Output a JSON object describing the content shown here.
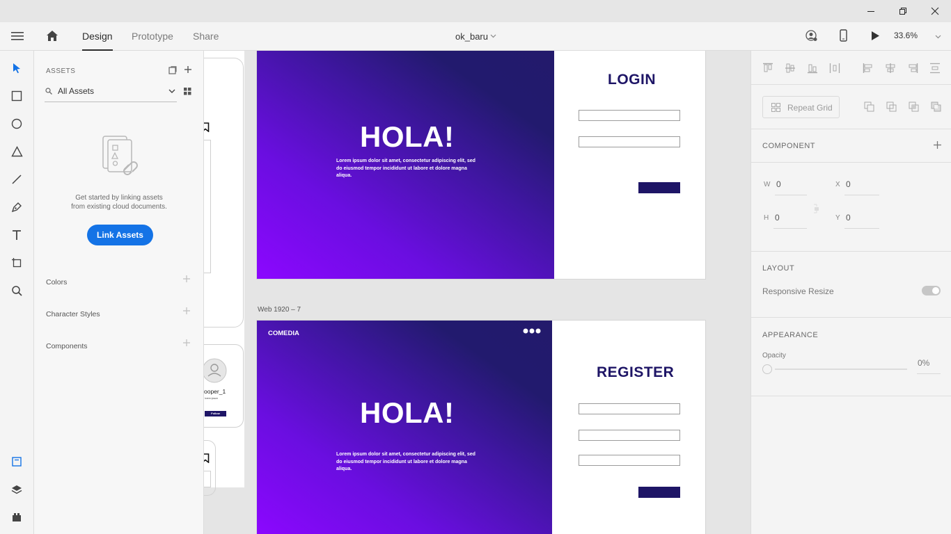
{
  "window": {
    "minimize_icon": "minimize-icon",
    "restore_icon": "restore-icon",
    "close_icon": "close-icon"
  },
  "toolbar": {
    "tabs": [
      {
        "label": "Design",
        "active": true
      },
      {
        "label": "Prototype",
        "active": false
      },
      {
        "label": "Share",
        "active": false
      }
    ],
    "document_name": "ok_baru",
    "zoom": "33.6%"
  },
  "assets_panel": {
    "title": "ASSETS",
    "search_value": "All Assets",
    "empty_text_line1": "Get started by linking assets",
    "empty_text_line2": "from existing cloud documents.",
    "link_button": "Link Assets",
    "sections": [
      "Colors",
      "Character Styles",
      "Components"
    ]
  },
  "canvas": {
    "partial_frame": {
      "username": "ooper_1",
      "sublabel": "lorem ipsum",
      "follow_label": "Follow"
    },
    "artboard_login": {
      "heading": "HOLA!",
      "body": "Lorem ipsum dolor sit amet, consectetur adipiscing elit, sed do eiusmod tempor incididunt ut labore et dolore magna aliqua.",
      "form_title": "LOGIN"
    },
    "artboard_register": {
      "label": "Web 1920 – 7",
      "brand": "COMEDIA",
      "heading": "HOLA!",
      "body": "Lorem ipsum dolor sit amet, consectetur adipiscing elit, sed do eiusmod tempor incididunt ut labore et dolore magna aliqua.",
      "form_title": "REGISTER"
    }
  },
  "properties": {
    "repeat_grid": "Repeat Grid",
    "component_label": "COMPONENT",
    "w_label": "W",
    "w_value": "0",
    "h_label": "H",
    "h_value": "0",
    "x_label": "X",
    "x_value": "0",
    "y_label": "Y",
    "y_value": "0",
    "layout_label": "LAYOUT",
    "responsive_resize": "Responsive Resize",
    "appearance_label": "APPEARANCE",
    "opacity_label": "Opacity",
    "opacity_value": "0%"
  },
  "colors": {
    "accent": "#1473e6",
    "form_dark": "#1e1566",
    "gradient_light": "#8c07ff",
    "gradient_dark": "#231a6c"
  }
}
